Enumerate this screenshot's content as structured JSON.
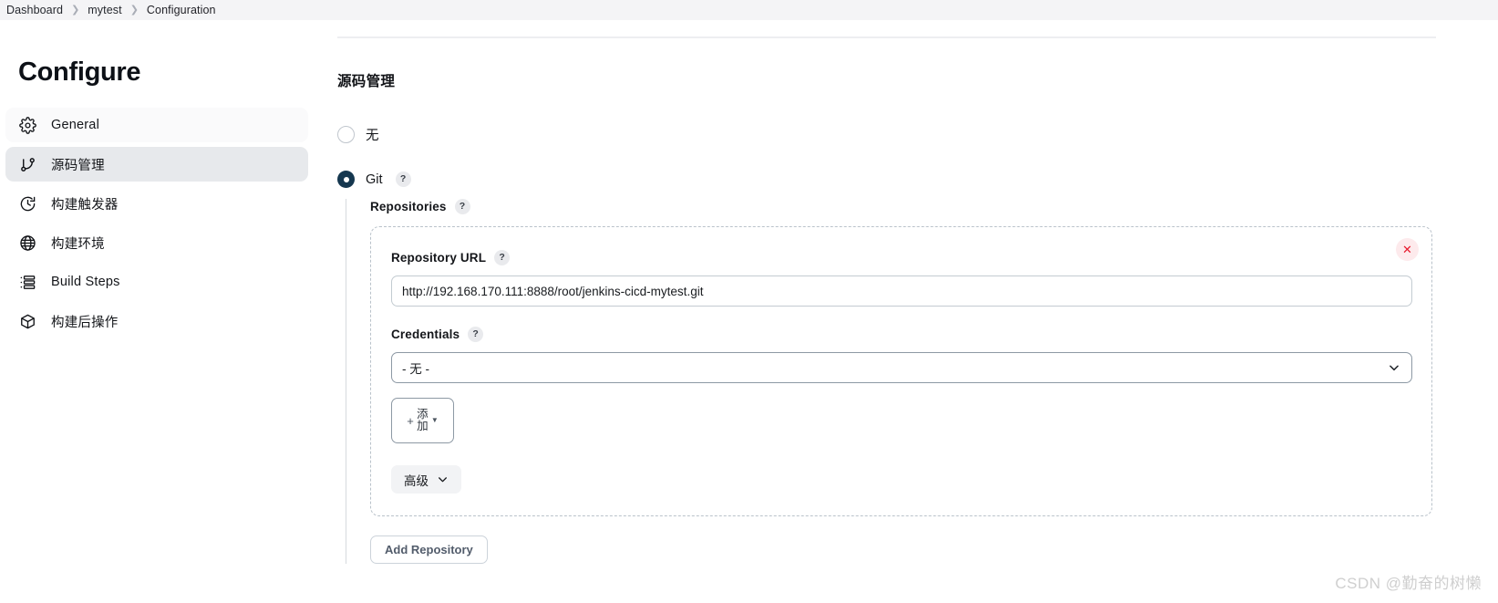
{
  "breadcrumb": {
    "separator": "❯",
    "items": [
      {
        "label": "Dashboard"
      },
      {
        "label": "mytest"
      },
      {
        "label": "Configuration"
      }
    ]
  },
  "page": {
    "title": "Configure"
  },
  "sidebar": {
    "items": [
      {
        "label": "General",
        "icon": "gear-icon",
        "state": "soft"
      },
      {
        "label": "源码管理",
        "icon": "git-branch-icon",
        "state": "active"
      },
      {
        "label": "构建触发器",
        "icon": "clock-icon",
        "state": "normal"
      },
      {
        "label": "构建环境",
        "icon": "globe-icon",
        "state": "normal"
      },
      {
        "label": "Build Steps",
        "icon": "list-icon",
        "state": "normal"
      },
      {
        "label": "构建后操作",
        "icon": "package-icon",
        "state": "normal"
      }
    ]
  },
  "main": {
    "section_title": "源码管理",
    "scm_options": [
      {
        "label": "无",
        "selected": false
      },
      {
        "label": "Git",
        "selected": true,
        "help": "?"
      }
    ],
    "repositories": {
      "label": "Repositories",
      "help": "?",
      "repository_url": {
        "label": "Repository URL",
        "help": "?",
        "value": "http://192.168.170.111:8888/root/jenkins-cicd-mytest.git",
        "placeholder": ""
      },
      "credentials": {
        "label": "Credentials",
        "help": "?",
        "selected": "- 无 -",
        "options": [
          "- 无 -"
        ],
        "add_button": {
          "plus": "+",
          "line1": "添",
          "line2": "加",
          "caret": "▼"
        }
      },
      "advanced_button": {
        "label": "高级",
        "caret_icon": "chevron-down-icon"
      },
      "delete_button": {
        "icon": "close-icon",
        "glyph": "✕"
      }
    },
    "add_repository_button": "Add Repository"
  },
  "watermark": "CSDN @勤奋的树懒",
  "colors": {
    "radio_selected": "#15374f",
    "delete_red": "#e8192c",
    "active_nav_bg": "#e7e9ec"
  }
}
